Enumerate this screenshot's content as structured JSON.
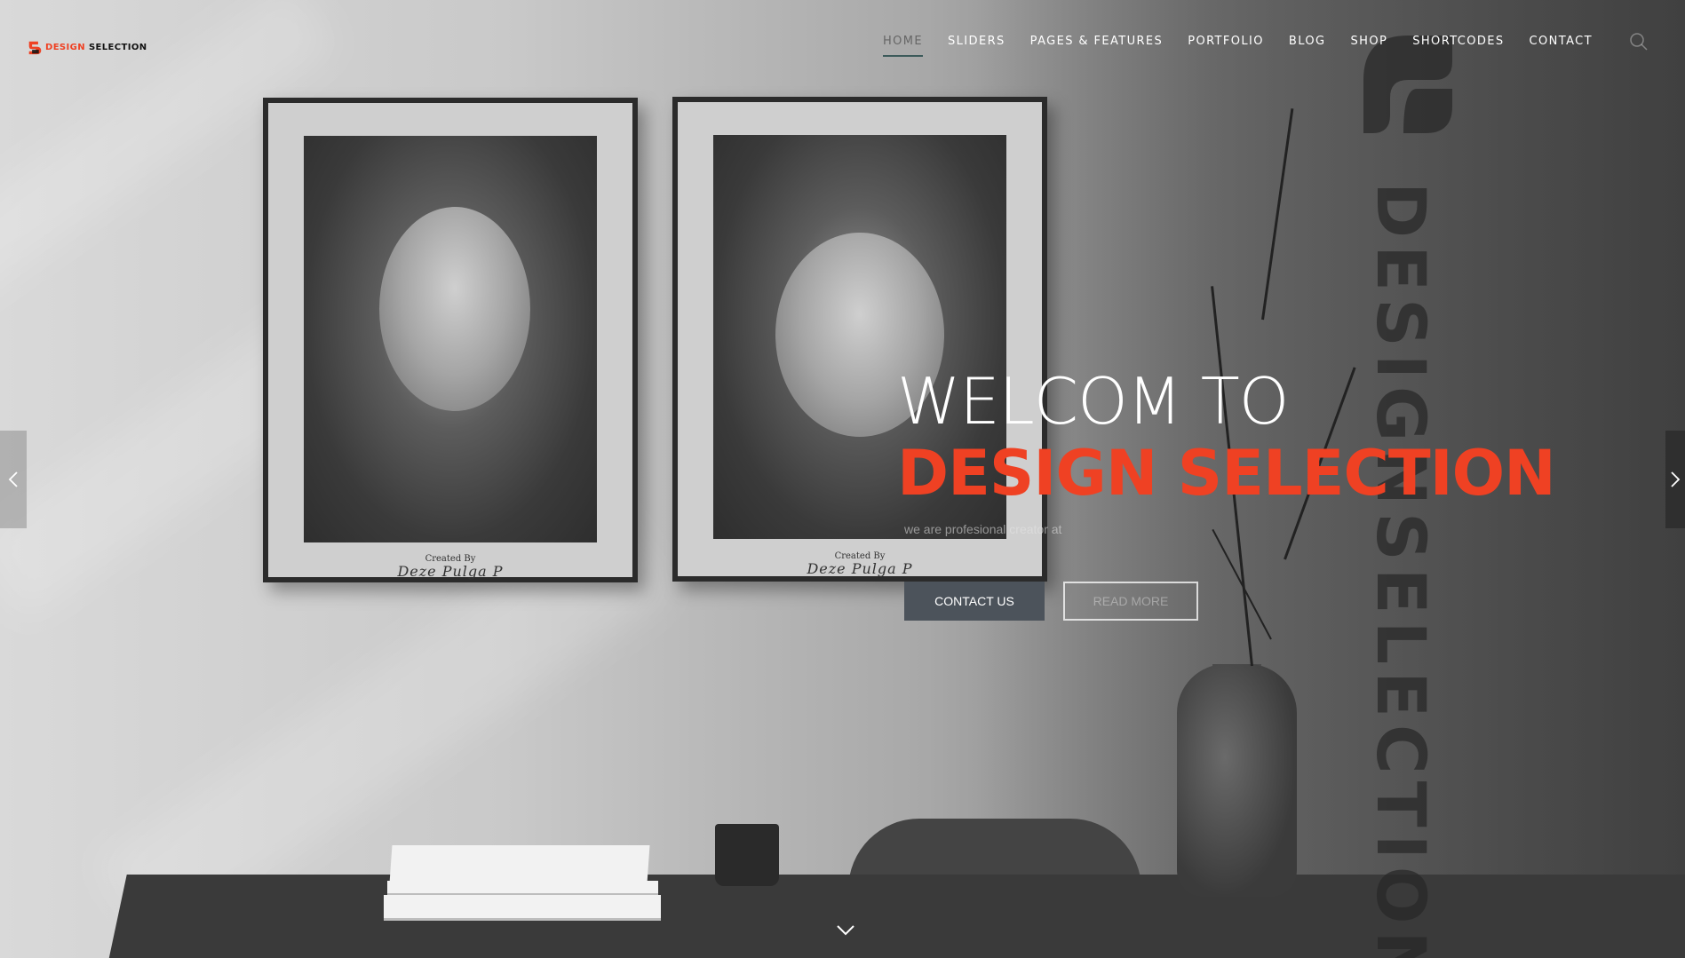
{
  "brand": {
    "logo_word1": "DESIGN",
    "logo_word2": "SELECTION",
    "accent_color": "#ef4123",
    "watermark_text": "DESIGNSELECTION"
  },
  "nav": {
    "items": [
      {
        "label": "HOME",
        "active": true
      },
      {
        "label": "SLIDERS"
      },
      {
        "label": "PAGES & FEATURES"
      },
      {
        "label": "PORTFOLIO"
      },
      {
        "label": "BLOG"
      },
      {
        "label": "SHOP"
      },
      {
        "label": "SHORTCODES"
      },
      {
        "label": "CONTACT"
      }
    ],
    "search_icon": "search-icon"
  },
  "hero": {
    "line1": "WELCOM TO",
    "line2": "DESIGN SELECTION",
    "subtitle": "we are profesional creator at",
    "contact_button": "CONTACT US",
    "read_more_button": "READ MORE"
  },
  "artwork": {
    "left_caption": "Created By",
    "left_signature": "Deze Pulga P",
    "right_caption": "Created By",
    "right_signature": "Deze Pulga P"
  },
  "controls": {
    "prev_icon": "chevron-left-icon",
    "next_icon": "chevron-right-icon",
    "scroll_icon": "chevron-down-icon"
  }
}
